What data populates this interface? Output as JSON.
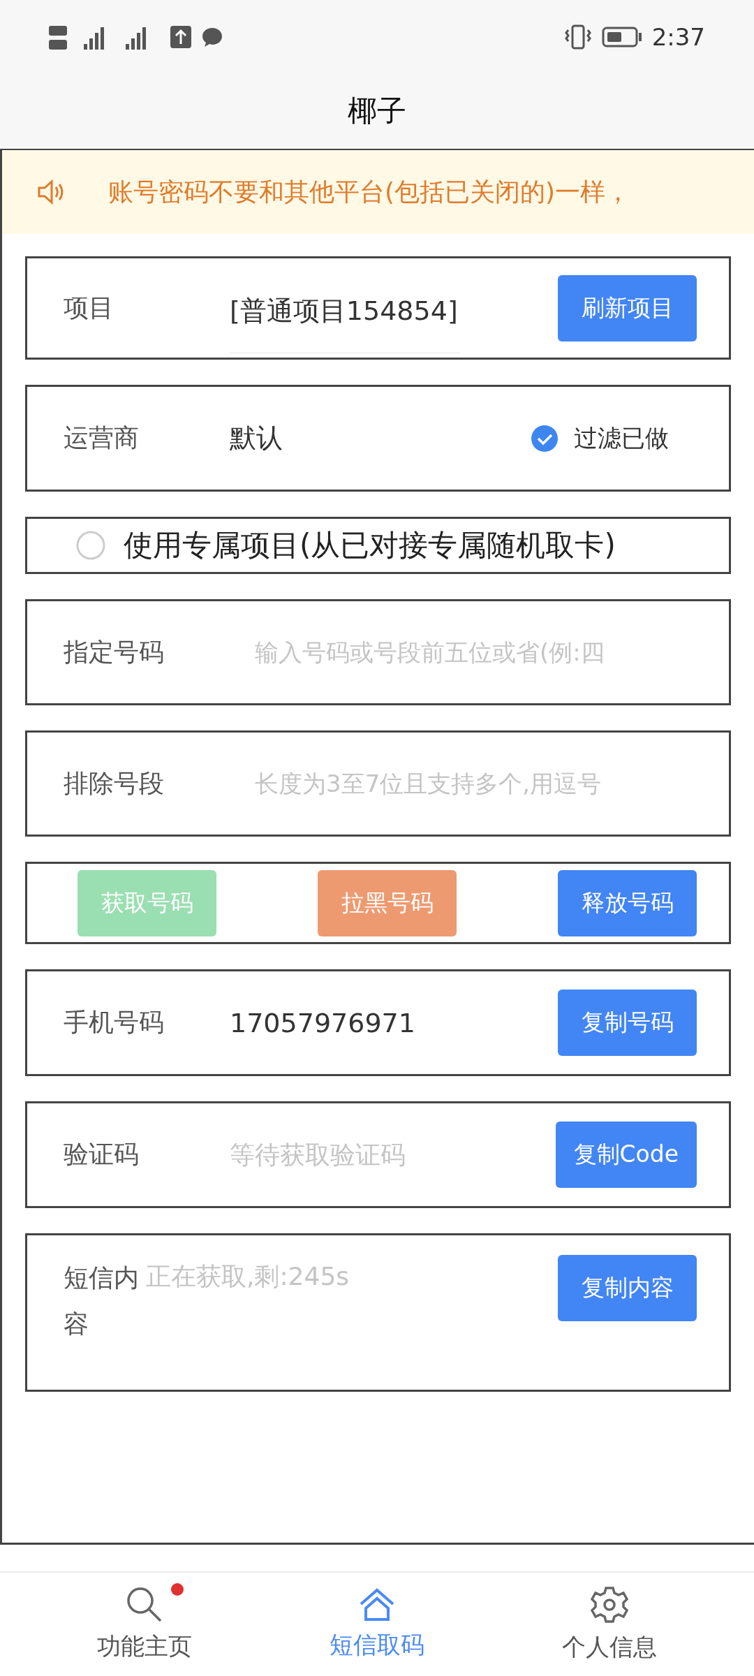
{
  "status_bar": {
    "time": "2:37"
  },
  "app_bar": {
    "title": "椰子"
  },
  "notice": {
    "text": "账号密码不要和其他平台(包括已关闭的)一样，"
  },
  "form": [
    {
      "kind": "field",
      "label": "项目",
      "value": "[普通项目154854]",
      "button": "刷新项目"
    },
    {
      "kind": "select",
      "label": "运营商",
      "value": "默认",
      "option": {
        "label": "过滤已做",
        "checked": true
      }
    },
    {
      "kind": "radio",
      "label": "使用专属项目(从已对接专属随机取卡)",
      "selected": false
    },
    {
      "kind": "input",
      "label": "指定号码",
      "placeholder": "输入号码或号段前五位或省(例:四"
    },
    {
      "kind": "input",
      "label": "排除号段",
      "placeholder": "长度为3至7位且支持多个,用逗号"
    },
    {
      "kind": "actions",
      "buttons": [
        {
          "label": "获取号码",
          "color": "#9adfb1"
        },
        {
          "label": "拉黑号码",
          "color": "#ee9a70"
        },
        {
          "label": "释放号码",
          "color": "#4285f4"
        }
      ]
    },
    {
      "kind": "output",
      "label": "手机号码",
      "value": "17057976971",
      "button": "复制号码"
    },
    {
      "kind": "output",
      "label": "验证码",
      "placeholder": "等待获取验证码",
      "button": "复制Code"
    },
    {
      "kind": "message",
      "label": "短信内容",
      "placeholder": "正在获取,剩:245s",
      "button": "复制内容"
    }
  ],
  "bottom_nav": [
    {
      "label": "功能主页",
      "selected": false,
      "badge": true
    },
    {
      "label": "短信取码",
      "selected": true,
      "badge": false
    },
    {
      "label": "个人信息",
      "selected": false,
      "badge": false
    }
  ]
}
